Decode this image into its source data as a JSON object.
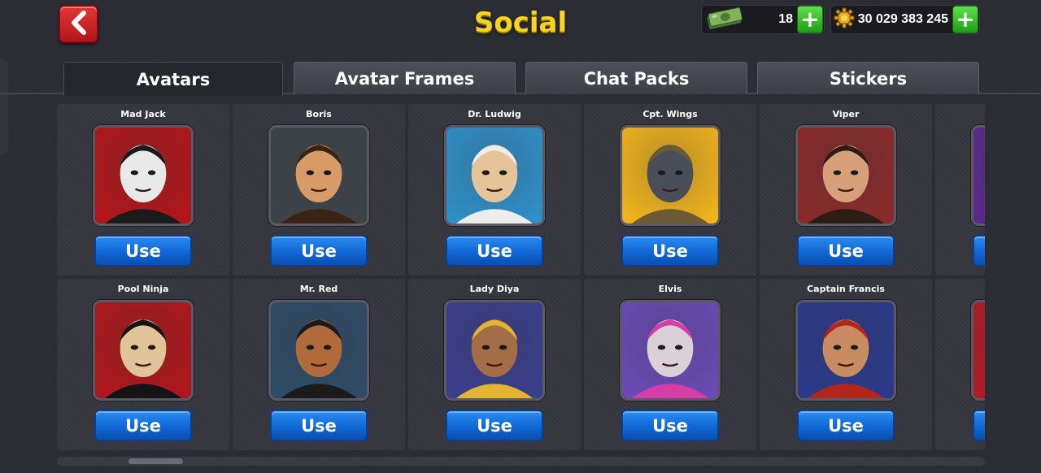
{
  "header": {
    "title": "Social",
    "cash_amount": "18",
    "coins_amount": "30 029 383 245"
  },
  "tabs": [
    {
      "label": "Avatars",
      "active": true
    },
    {
      "label": "Avatar Frames",
      "active": false
    },
    {
      "label": "Chat Packs",
      "active": false
    },
    {
      "label": "Stickers",
      "active": false
    }
  ],
  "avatars": [
    {
      "name": "Mad Jack",
      "button": "Use",
      "palette": [
        "#b2161a",
        "#e9e9e9",
        "#1b1b1b"
      ]
    },
    {
      "name": "Boris",
      "button": "Use",
      "palette": [
        "#3d4448",
        "#d79b6a",
        "#3a2415"
      ]
    },
    {
      "name": "Dr. Ludwig",
      "button": "Use",
      "palette": [
        "#2f8fc8",
        "#e6c49a",
        "#ececec"
      ]
    },
    {
      "name": "Cpt. Wings",
      "button": "Use",
      "palette": [
        "#f0b31d",
        "#4a4e58",
        "#6b5a34"
      ]
    },
    {
      "name": "Viper",
      "button": "Use",
      "palette": [
        "#8b2a2a",
        "#d8a07a",
        "#2e1c16"
      ]
    },
    {
      "name": "",
      "button": "Use",
      "palette": [
        "#5b2b8c",
        "#f2c25a",
        "#2a1a3a"
      ]
    },
    {
      "name": "Pool Ninja",
      "button": "Use",
      "palette": [
        "#b0171b",
        "#e1c49a",
        "#141414"
      ]
    },
    {
      "name": "Mr. Red",
      "button": "Use",
      "palette": [
        "#2e4c66",
        "#b06a3c",
        "#1b1b1b"
      ]
    },
    {
      "name": "Lady Diya",
      "button": "Use",
      "palette": [
        "#3a3f8c",
        "#a36e47",
        "#e2b431"
      ]
    },
    {
      "name": "Elvis",
      "button": "Use",
      "palette": [
        "#6a4bb5",
        "#d8d2d6",
        "#d63da8"
      ]
    },
    {
      "name": "Captain Francis",
      "button": "Use",
      "palette": [
        "#2b3a8c",
        "#c98b62",
        "#b3261e"
      ]
    },
    {
      "name": "",
      "button": "Use",
      "palette": [
        "#b01c25",
        "#d9a07a",
        "#3a1416"
      ]
    }
  ],
  "scroll": {
    "position_fraction": 0.04
  }
}
